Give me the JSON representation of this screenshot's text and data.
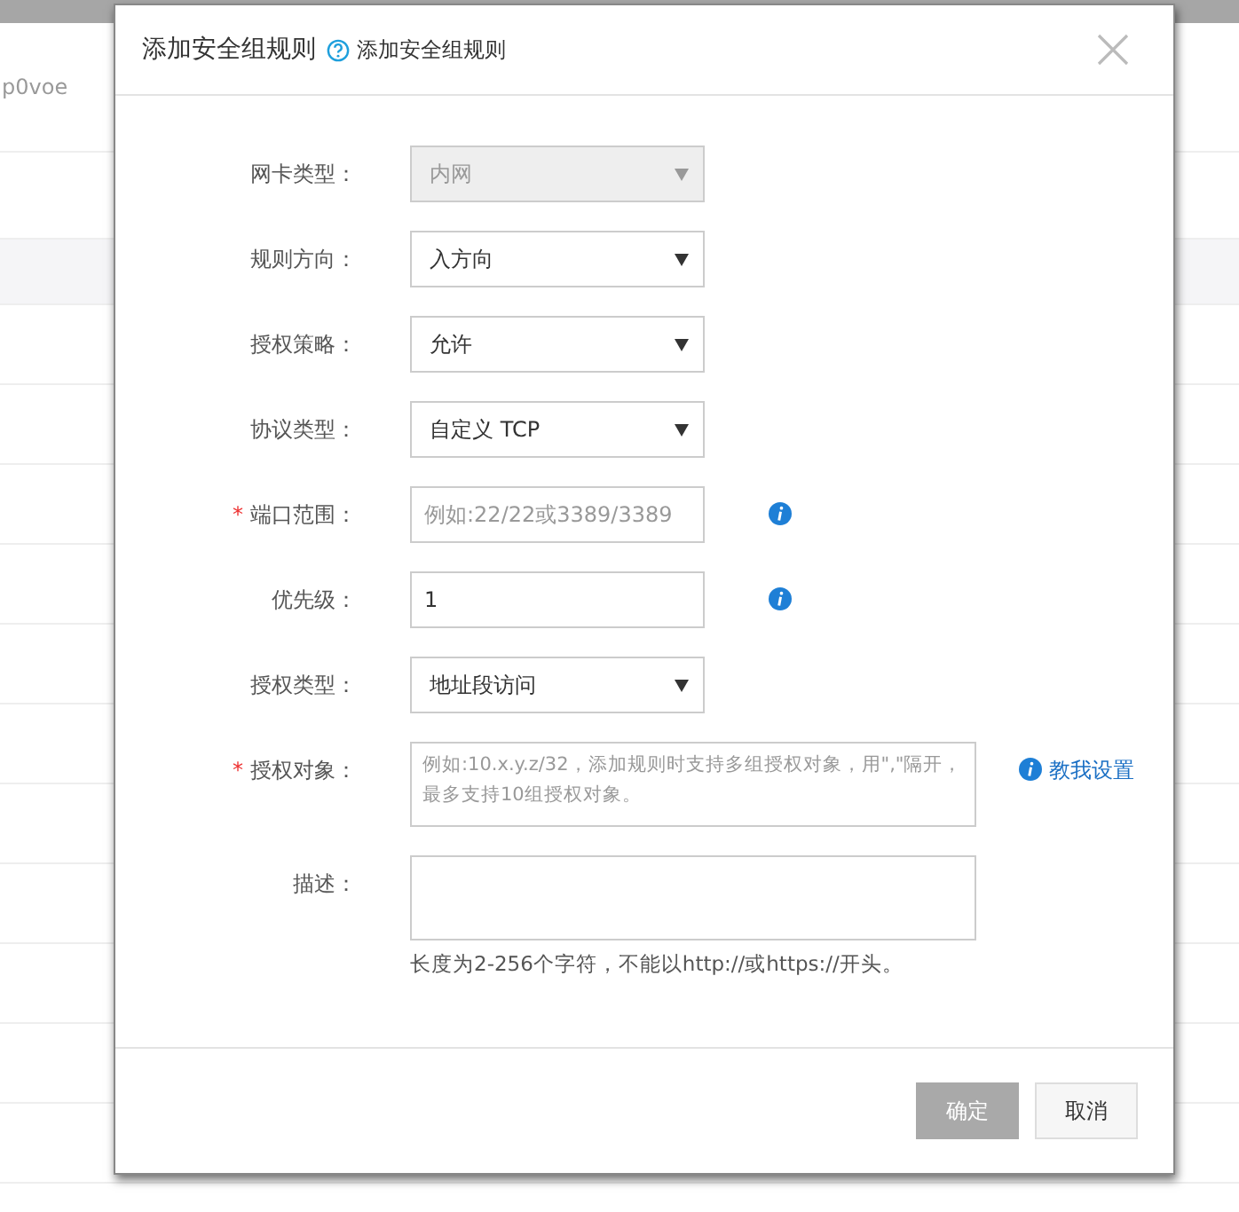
{
  "background": {
    "instance_id": "p0voe"
  },
  "dialog": {
    "title": "添加安全组规则",
    "help_text": "添加安全组规则",
    "fields": [
      {
        "label": "网卡类型：",
        "kind": "select",
        "value": "内网",
        "disabled": true
      },
      {
        "label": "规则方向：",
        "kind": "select",
        "value": "入方向"
      },
      {
        "label": "授权策略：",
        "kind": "select",
        "value": "允许"
      },
      {
        "label": "协议类型：",
        "kind": "select",
        "value": "自定义 TCP"
      },
      {
        "label": "端口范围：",
        "kind": "input",
        "placeholder": "例如:22/22或3389/3389",
        "required_mark": "*",
        "info": true
      },
      {
        "label": "优先级：",
        "kind": "input",
        "value": "1",
        "info": true
      },
      {
        "label": "授权类型：",
        "kind": "select",
        "value": "地址段访问"
      },
      {
        "label": "授权对象：",
        "kind": "textarea",
        "placeholder": "例如:10.x.y.z/32，添加规则时支持多组授权对象，用\",\"隔开，最多支持10组授权对象。",
        "required_mark": "*",
        "info": true,
        "link": "教我设置"
      },
      {
        "label": "描述：",
        "kind": "textarea",
        "hint": "长度为2-256个字符，不能以http://或https://开头。"
      }
    ],
    "buttons": [
      {
        "label": "确定",
        "kind": "primary",
        "disabled": true
      },
      {
        "label": "取消",
        "kind": "default",
        "disabled": false
      }
    ]
  }
}
